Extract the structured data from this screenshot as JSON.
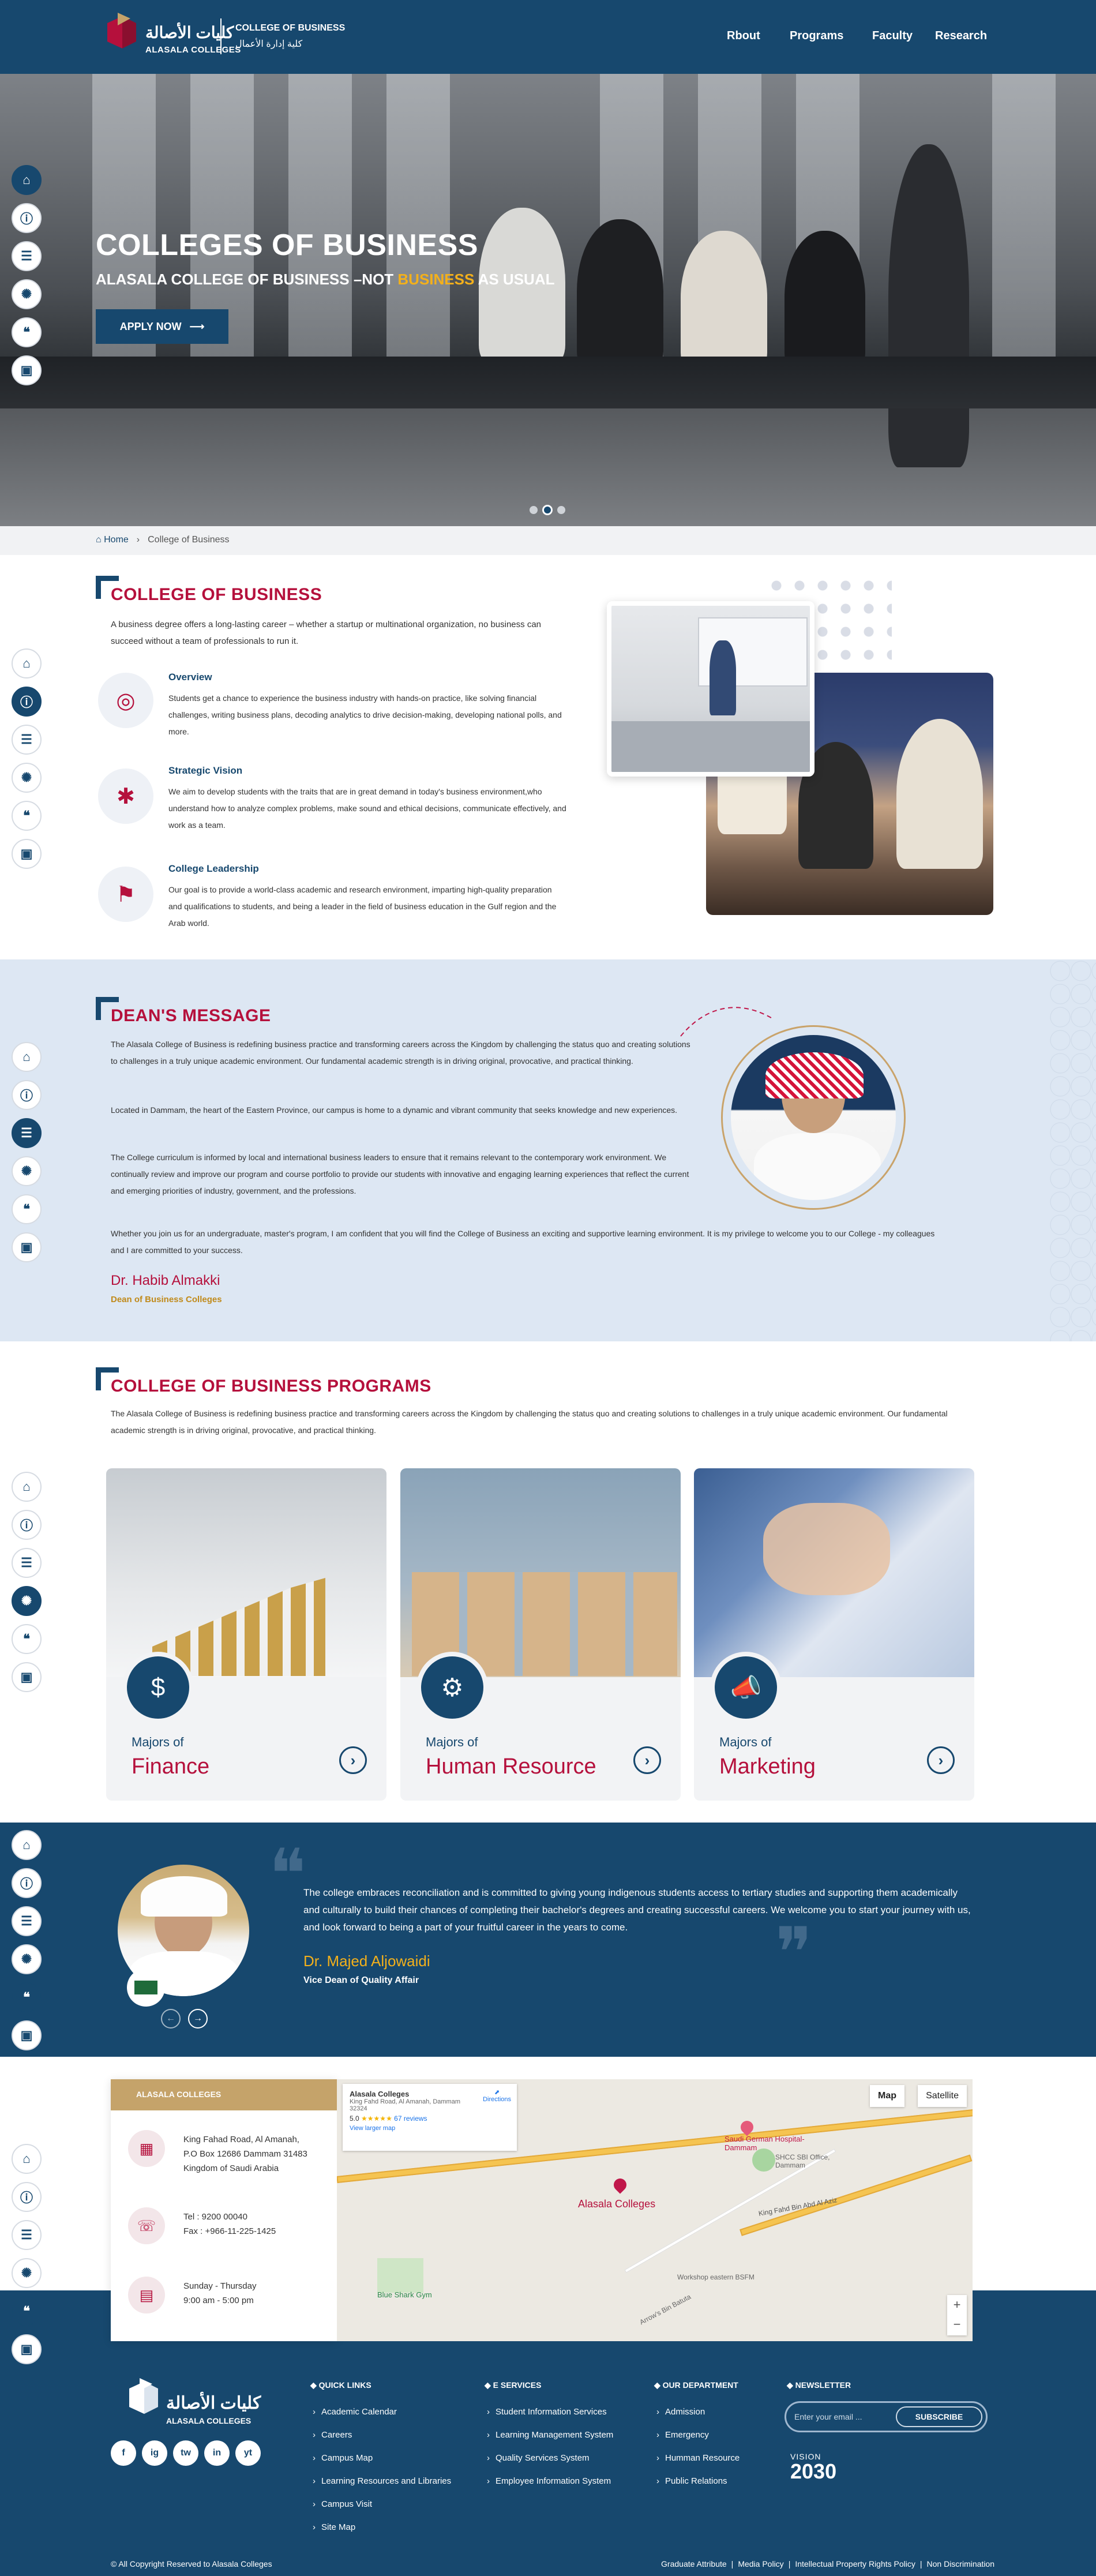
{
  "header": {
    "logo_ar": "كليات الأصالة",
    "logo_en": "ALASALA COLLEGES",
    "college_en": "COLLEGE OF BUSINESS",
    "college_ar": "كلية إدارة الأعمال",
    "nav": [
      "Rbout",
      "Programs",
      "Faculty",
      "Research"
    ]
  },
  "hero": {
    "title": "COLLEGES OF BUSINESS",
    "subtitle_pre": "ALASALA COLLEGE OF BUSINESS –NOT ",
    "subtitle_hl": "BUSINESS",
    "subtitle_post": " AS USUAL",
    "cta": "APPLY NOW",
    "slides": 3,
    "active_slide": 2
  },
  "rail": [
    "home-icon",
    "info-icon",
    "chat-icon",
    "sparkle-icon",
    "quote-icon",
    "map-icon"
  ],
  "breadcrumb": {
    "home": "Home",
    "current": "College of Business"
  },
  "about": {
    "title": "COLLEGE OF BUSINESS",
    "intro": "A business degree offers a long-lasting career – whether a startup or multinational organization, no business can succeed without a team of professionals to run it.",
    "features": [
      {
        "icon": "target-icon",
        "title": "Overview",
        "text": "Students get a chance to experience the business industry with hands-on practice, like solving financial challenges, writing business plans, decoding analytics to drive decision-making, developing national polls, and more."
      },
      {
        "icon": "lightbulb-icon",
        "title": "Strategic Vision",
        "text": "We aim to develop students with the traits that are in great demand in today's business environment,who understand how to analyze complex problems, make sound and ethical decisions, communicate effectively, and work as a team."
      },
      {
        "icon": "leader-icon",
        "title": "College Leadership",
        "text": "Our goal is to provide a world-class academic and research environment, imparting high-quality preparation and qualifications to students, and being a leader in the field of business education in the Gulf region and the Arab world."
      }
    ]
  },
  "dean": {
    "title": "DEAN'S MESSAGE",
    "paragraphs": [
      "The Alasala College of Business is redefining business practice and transforming careers across the Kingdom by challenging the status quo and creating solutions to challenges in a truly unique academic environment. Our fundamental academic strength is in driving original, provocative, and practical thinking.",
      "Located in Dammam, the heart of the Eastern Province, our campus is home to a dynamic and vibrant community that seeks knowledge and new experiences.",
      "The College curriculum is informed by local and international business leaders to ensure that it remains relevant to the contemporary work environment. We continually review and improve our program and course portfolio to provide our students with innovative and engaging learning experiences that reflect the current and emerging priorities of industry, government, and the professions.",
      "Whether you join us for an undergraduate, master's program, I am confident that you will find the College of Business an exciting and supportive learning environment. It is my privilege to welcome you to our College - my colleagues and I are committed to your success."
    ],
    "name": "Dr. Habib Almakki",
    "role": "Dean of Business Colleges"
  },
  "programs": {
    "title": "COLLEGE OF BUSINESS PROGRAMS",
    "intro": "The Alasala College of Business is redefining business practice and transforming careers across the Kingdom by challenging the status quo and creating solutions to challenges in a truly unique academic environment. Our fundamental academic strength is in driving original, provocative, and practical thinking.",
    "cards": [
      {
        "majors": "Majors of",
        "name": "Finance",
        "icon": "finance-icon"
      },
      {
        "majors": "Majors of",
        "name": "Human Resource",
        "icon": "hr-icon"
      },
      {
        "majors": "Majors of",
        "name": "Marketing",
        "icon": "megaphone-icon"
      }
    ]
  },
  "vice_dean": {
    "text": "The college embraces reconciliation and is committed to giving young indigenous students access to tertiary studies and supporting them academically and culturally to build their chances of completing their bachelor's degrees and creating successful careers. We welcome you to start your journey with us, and look forward to being a part of your fruitful career in the years to come.",
    "name": "Dr. Majed Aljowaidi",
    "role": "Vice Dean of Quality Affair"
  },
  "contact": {
    "head": "ALASALA COLLEGES",
    "address": [
      "King Fahad Road, Al Amanah,",
      "P.O Box 12686 Dammam 31483",
      "Kingdom of Saudi Arabia"
    ],
    "phone": [
      "Tel : 9200 00040",
      "Fax : +966-11-225-1425"
    ],
    "hours": [
      "Sunday - Thursday",
      "9:00 am - 5:00 pm"
    ]
  },
  "map": {
    "place": "Alasala Colleges",
    "address": "King Fahd Road, Al Amanah, Dammam 32324",
    "rating": "5.0",
    "stars": "★★★★★",
    "reviews": "67 reviews",
    "larger": "View larger map",
    "directions": "Directions",
    "toggle": [
      "Map",
      "Satellite"
    ],
    "road_label": "King Fahd Bin Abd Al Aziz",
    "poi": [
      "Saudi German Hospital-Dammam",
      "SHCC SBI Office, Dammam",
      "Blue Shark Gym",
      "Workshop eastern BSFM",
      "Arrow's Bin Batuta"
    ]
  },
  "footer": {
    "logo_ar": "كليات الأصالة",
    "logo_en": "ALASALA COLLEGES",
    "socials": [
      "f",
      "ig",
      "tw",
      "in",
      "yt"
    ],
    "columns": [
      {
        "title": "QUICK LINKS",
        "items": [
          "Academic Calendar",
          "Careers",
          "Campus Map",
          "Learning Resources and Libraries",
          "Campus Visit",
          "Site Map"
        ]
      },
      {
        "title": "E SERVICES",
        "items": [
          "Student Information Services",
          "Learning Management System",
          "Quality Services System",
          "Employee Information System"
        ]
      },
      {
        "title": "OUR DEPARTMENT",
        "items": [
          "Admission",
          "Emergency",
          "Humman Resource",
          "Public Relations"
        ]
      }
    ],
    "newsletter_title": "NEWSLETTER",
    "email_placeholder": "Enter your email ...",
    "subscribe": "SUBSCRIBE",
    "vision": "VISION",
    "vision_year": "2030",
    "copyright": "© All Copyright Reserved to Alasala Colleges",
    "legal": [
      "Graduate Attribute",
      "Media Policy",
      "Intellectual Property Rights Policy",
      "Non Discrimination"
    ]
  }
}
